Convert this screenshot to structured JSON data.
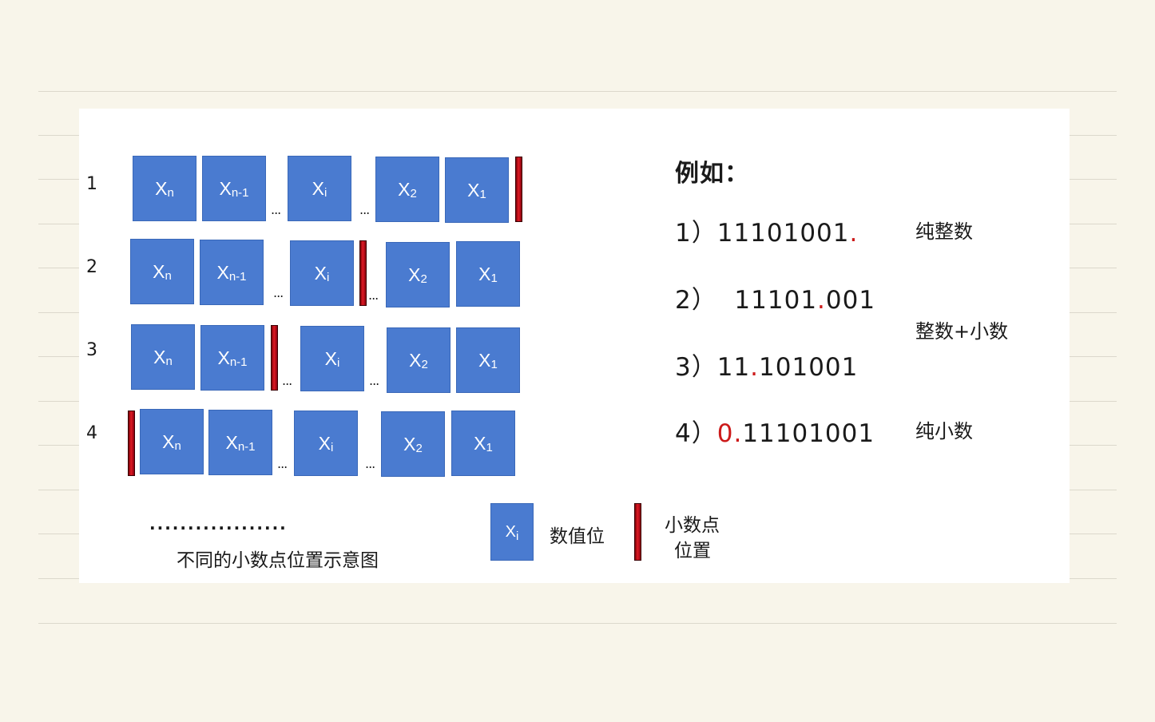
{
  "diagram": {
    "rows": [
      {
        "label": "1",
        "items": [
          {
            "t": "cell",
            "sym": "X",
            "sub": "n"
          },
          {
            "t": "cell",
            "sym": "X",
            "sub": "n-1"
          },
          {
            "t": "dots"
          },
          {
            "t": "cell",
            "sym": "X",
            "sub": "i"
          },
          {
            "t": "dots"
          },
          {
            "t": "cell",
            "sym": "X",
            "sub": "2"
          },
          {
            "t": "cell",
            "sym": "X",
            "sub": "1"
          },
          {
            "t": "point"
          }
        ]
      },
      {
        "label": "2",
        "items": [
          {
            "t": "cell",
            "sym": "X",
            "sub": "n"
          },
          {
            "t": "cell",
            "sym": "X",
            "sub": "n-1"
          },
          {
            "t": "dots"
          },
          {
            "t": "cell",
            "sym": "X",
            "sub": "i"
          },
          {
            "t": "point"
          },
          {
            "t": "dots"
          },
          {
            "t": "cell",
            "sym": "X",
            "sub": "2"
          },
          {
            "t": "cell",
            "sym": "X",
            "sub": "1"
          }
        ]
      },
      {
        "label": "3",
        "items": [
          {
            "t": "cell",
            "sym": "X",
            "sub": "n"
          },
          {
            "t": "cell",
            "sym": "X",
            "sub": "n-1"
          },
          {
            "t": "point"
          },
          {
            "t": "dots"
          },
          {
            "t": "cell",
            "sym": "X",
            "sub": "i"
          },
          {
            "t": "dots"
          },
          {
            "t": "cell",
            "sym": "X",
            "sub": "2"
          },
          {
            "t": "cell",
            "sym": "X",
            "sub": "1"
          }
        ]
      },
      {
        "label": "4",
        "items": [
          {
            "t": "point"
          },
          {
            "t": "cell",
            "sym": "X",
            "sub": "n"
          },
          {
            "t": "cell",
            "sym": "X",
            "sub": "n-1"
          },
          {
            "t": "dots"
          },
          {
            "t": "cell",
            "sym": "X",
            "sub": "i"
          },
          {
            "t": "dots"
          },
          {
            "t": "cell",
            "sym": "X",
            "sub": "2"
          },
          {
            "t": "cell",
            "sym": "X",
            "sub": "1"
          }
        ]
      }
    ],
    "dots_text": "...",
    "caption_dots": "..................",
    "caption": "不同的小数点位置示意图",
    "legend": {
      "cell_sym": "X",
      "cell_sub": "i",
      "cell_label": "数值位",
      "point_label_line1": "小数点",
      "point_label_line2": "位置"
    }
  },
  "examples": {
    "heading": "例如：",
    "items": [
      {
        "prefix": "1）11101001",
        "point": ".",
        "suffix": "",
        "category": "纯整数"
      },
      {
        "prefix": "2）  11101",
        "point": ".",
        "suffix": "001",
        "category": ""
      },
      {
        "prefix": "3）11",
        "point": ".",
        "suffix": "101001",
        "category": ""
      },
      {
        "prefix": "4）",
        "point": "0.",
        "suffix": "11101001",
        "category": "纯小数"
      }
    ],
    "shared_category": "整数+小数"
  },
  "colors": {
    "cell": "#4a7bd0",
    "point_bar": "#d0101a",
    "accent_red": "#cc1a1a",
    "background": "#f8f5ea"
  }
}
